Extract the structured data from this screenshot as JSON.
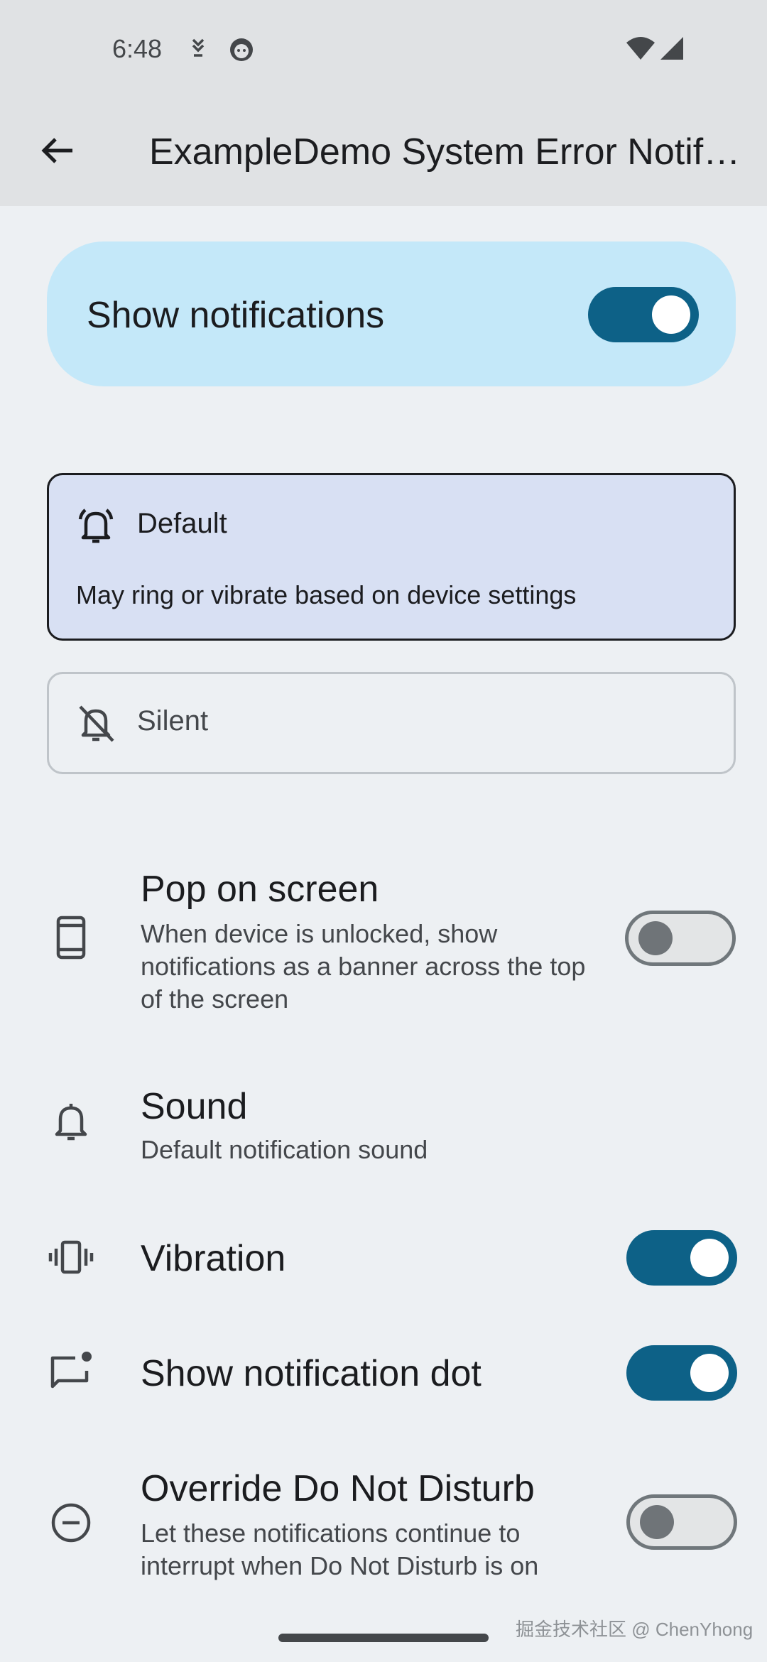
{
  "status_bar": {
    "time": "6:48",
    "icons": [
      "download-icon",
      "face-icon",
      "wifi-icon",
      "signal-icon"
    ]
  },
  "app_bar": {
    "back_icon": "arrow-back-icon",
    "title": "ExampleDemo System Error Notifications"
  },
  "master": {
    "label": "Show notifications",
    "enabled": true
  },
  "importance": {
    "default": {
      "label": "Default",
      "description": "May ring or vibrate based on device settings",
      "icon": "bell-ring-icon",
      "selected": true
    },
    "silent": {
      "label": "Silent",
      "icon": "bell-off-icon",
      "selected": false
    }
  },
  "settings": {
    "pop_on_screen": {
      "title": "Pop on screen",
      "subtitle": "When device is unlocked, show notifications as a banner across the top of the screen",
      "icon": "phone-icon",
      "enabled": false
    },
    "sound": {
      "title": "Sound",
      "subtitle": "Default notification sound",
      "icon": "bell-icon"
    },
    "vibration": {
      "title": "Vibration",
      "icon": "vibration-icon",
      "enabled": true
    },
    "notification_dot": {
      "title": "Show notification dot",
      "icon": "chat-dot-icon",
      "enabled": true
    },
    "override_dnd": {
      "title": "Override Do Not Disturb",
      "subtitle": "Let these notifications continue to interrupt when Do Not Disturb is on",
      "icon": "do-not-disturb-icon",
      "enabled": false
    }
  },
  "watermark": "掘金技术社区 @ ChenYhong",
  "colors": {
    "accent": "#0d6187",
    "master_card": "#c4e8f9",
    "selected_option": "#d8e0f3"
  }
}
